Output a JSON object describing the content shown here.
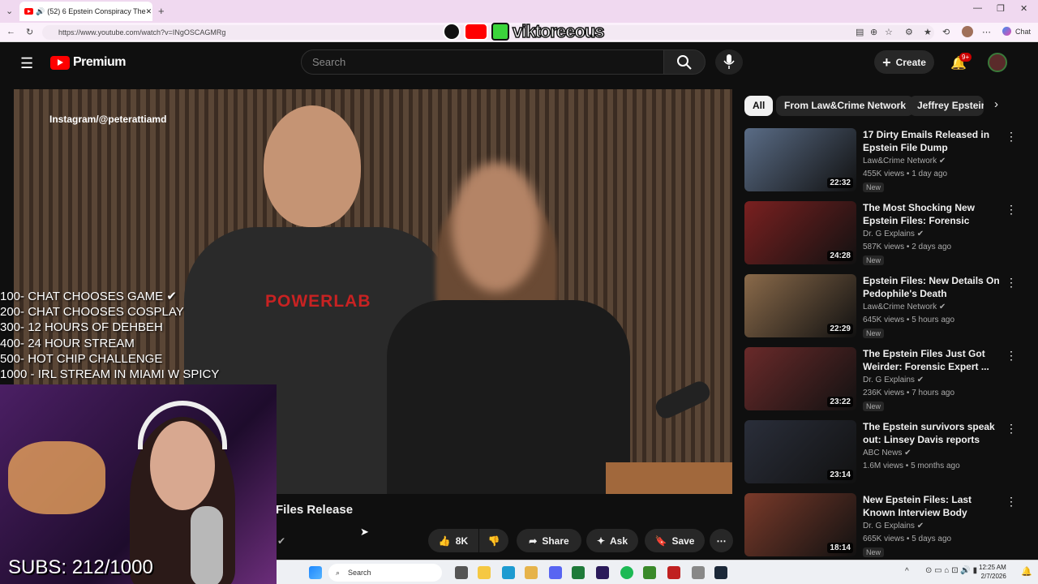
{
  "browser": {
    "tab_title": "(52) 6 Epstein Conspiracy The",
    "url": "https://www.youtube.com/watch?v=INgOSCAGMRg",
    "chat_label": "Chat"
  },
  "header": {
    "brand": "Premium",
    "search_placeholder": "Search",
    "create_label": "Create",
    "notifications_badge": "9+"
  },
  "video": {
    "watermark": "Instagram/@peterattiamd",
    "shirt_text": "POWERLAB",
    "title_partial": "Files Release",
    "likes": "8K",
    "share_label": "Share",
    "ask_label": "Ask",
    "save_label": "Save"
  },
  "chips": [
    "All",
    "From Law&Crime Network",
    "Jeffrey Epstein"
  ],
  "recommendations": [
    {
      "title": "17 Dirty Emails Released in Epstein File Dump",
      "channel": "Law&Crime Network",
      "meta": "455K views • 1 day ago",
      "badge": "New",
      "duration": "22:32",
      "thumb_color": "#5a6c86"
    },
    {
      "title": "The Most Shocking New Epstein Files: Forensic Expert ...",
      "channel": "Dr. G Explains",
      "meta": "587K views • 2 days ago",
      "badge": "New",
      "duration": "24:28",
      "thumb_color": "#7a2020"
    },
    {
      "title": "Epstein Files: New Details On Pedophile's Death",
      "channel": "Law&Crime Network",
      "meta": "645K views • 5 hours ago",
      "badge": "New",
      "duration": "22:29",
      "thumb_color": "#8a6a4a"
    },
    {
      "title": "The Epstein Files Just Got Weirder: Forensic Expert ...",
      "channel": "Dr. G Explains",
      "meta": "236K views • 7 hours ago",
      "badge": "New",
      "duration": "23:22",
      "thumb_color": "#6a2a2a"
    },
    {
      "title": "The Epstein survivors speak out: Linsey Davis reports",
      "channel": "ABC News",
      "meta": "1.6M views • 5 months ago",
      "badge": "",
      "duration": "23:14",
      "thumb_color": "#2a2e3a"
    },
    {
      "title": "New Epstein Files: Last Known Interview Body Language ...",
      "channel": "Dr. G Explains",
      "meta": "665K views • 5 days ago",
      "badge": "New",
      "duration": "18:14",
      "thumb_color": "#7a3a2a"
    }
  ],
  "overlay": {
    "streamer_brand": "viktoreeous",
    "goals": [
      "100- CHAT CHOOSES GAME ✔",
      "200- CHAT CHOOSES COSPLAY",
      "300- 12 HOURS OF DEHBEH",
      "400- 24 HOUR STREAM",
      "500- HOT CHIP CHALLENGE",
      "1000 - IRL STREAM IN MIAMI W SPICY"
    ],
    "subs": "SUBS: 212/1000"
  },
  "taskbar": {
    "search_label": "Search",
    "time": "12:25 AM",
    "date": "2/7/2026"
  },
  "colors": {
    "yt_red": "#ff0000",
    "bg": "#0f0f0f",
    "chip_active": "#f1f1f1"
  }
}
